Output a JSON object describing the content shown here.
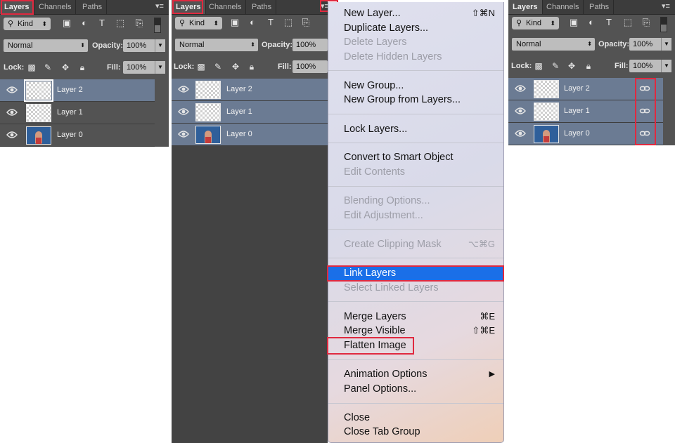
{
  "tabs": {
    "layers": "Layers",
    "channels": "Channels",
    "paths": "Paths"
  },
  "filter": {
    "kind_label": "Kind"
  },
  "blend": {
    "mode": "Normal",
    "opacity_label": "Opacity:",
    "opacity_value": "100%"
  },
  "lock": {
    "label": "Lock:",
    "fill_label": "Fill:",
    "fill_value": "100%"
  },
  "layers": [
    {
      "name": "Layer 2"
    },
    {
      "name": "Layer 1"
    },
    {
      "name": "Layer 0"
    }
  ],
  "menu": {
    "new_layer": "New Layer...",
    "new_layer_sc": "⇧⌘N",
    "duplicate_layers": "Duplicate Layers...",
    "delete_layers": "Delete Layers",
    "delete_hidden_layers": "Delete Hidden Layers",
    "new_group": "New Group...",
    "new_group_from_layers": "New Group from Layers...",
    "lock_layers": "Lock Layers...",
    "convert_smart_object": "Convert to Smart Object",
    "edit_contents": "Edit Contents",
    "blending_options": "Blending Options...",
    "edit_adjustment": "Edit Adjustment...",
    "create_clipping_mask": "Create Clipping Mask",
    "create_clipping_mask_sc": "⌥⌘G",
    "link_layers": "Link Layers",
    "select_linked_layers": "Select Linked Layers",
    "merge_layers": "Merge Layers",
    "merge_layers_sc": "⌘E",
    "merge_visible": "Merge Visible",
    "merge_visible_sc": "⇧⌘E",
    "flatten_image": "Flatten Image",
    "animation_options": "Animation Options",
    "panel_options": "Panel Options...",
    "close": "Close",
    "close_tab_group": "Close Tab Group"
  },
  "colors": {
    "panel_bg": "#535353",
    "selected_layer": "#6b7b93",
    "menu_highlight": "#1a6fe8",
    "annotation_red": "#e0293f"
  }
}
